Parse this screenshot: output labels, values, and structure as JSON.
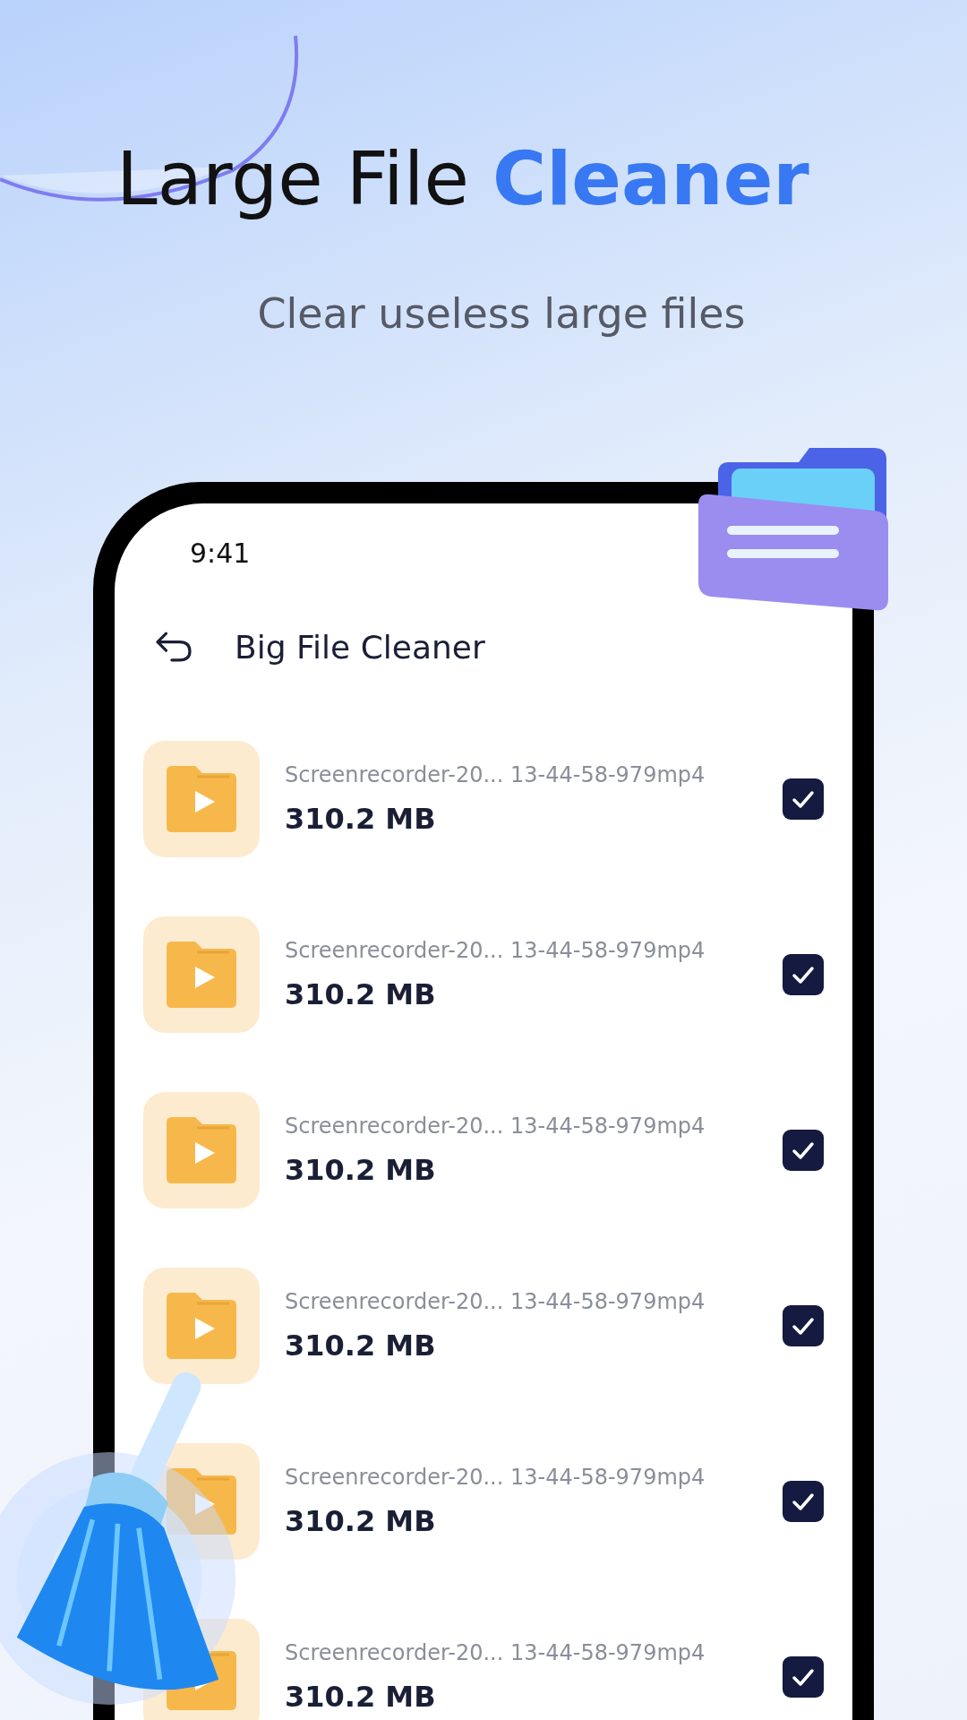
{
  "headline": {
    "text": "Large File",
    "highlight": "Cleaner"
  },
  "subtitle": "Clear useless large files",
  "phone": {
    "time": "9:41",
    "title": "Big File Cleaner",
    "files": [
      {
        "name": "Screenrecorder-20... 13-44-58-979mp4",
        "size": "310.2 MB",
        "checked": true
      },
      {
        "name": "Screenrecorder-20... 13-44-58-979mp4",
        "size": "310.2 MB",
        "checked": true
      },
      {
        "name": "Screenrecorder-20... 13-44-58-979mp4",
        "size": "310.2 MB",
        "checked": true
      },
      {
        "name": "Screenrecorder-20... 13-44-58-979mp4",
        "size": "310.2 MB",
        "checked": true
      },
      {
        "name": "Screenrecorder-20... 13-44-58-979mp4",
        "size": "310.2 MB",
        "checked": true
      },
      {
        "name": "Screenrecorder-20... 13-44-58-979mp4",
        "size": "310.2 MB",
        "checked": true
      }
    ]
  }
}
